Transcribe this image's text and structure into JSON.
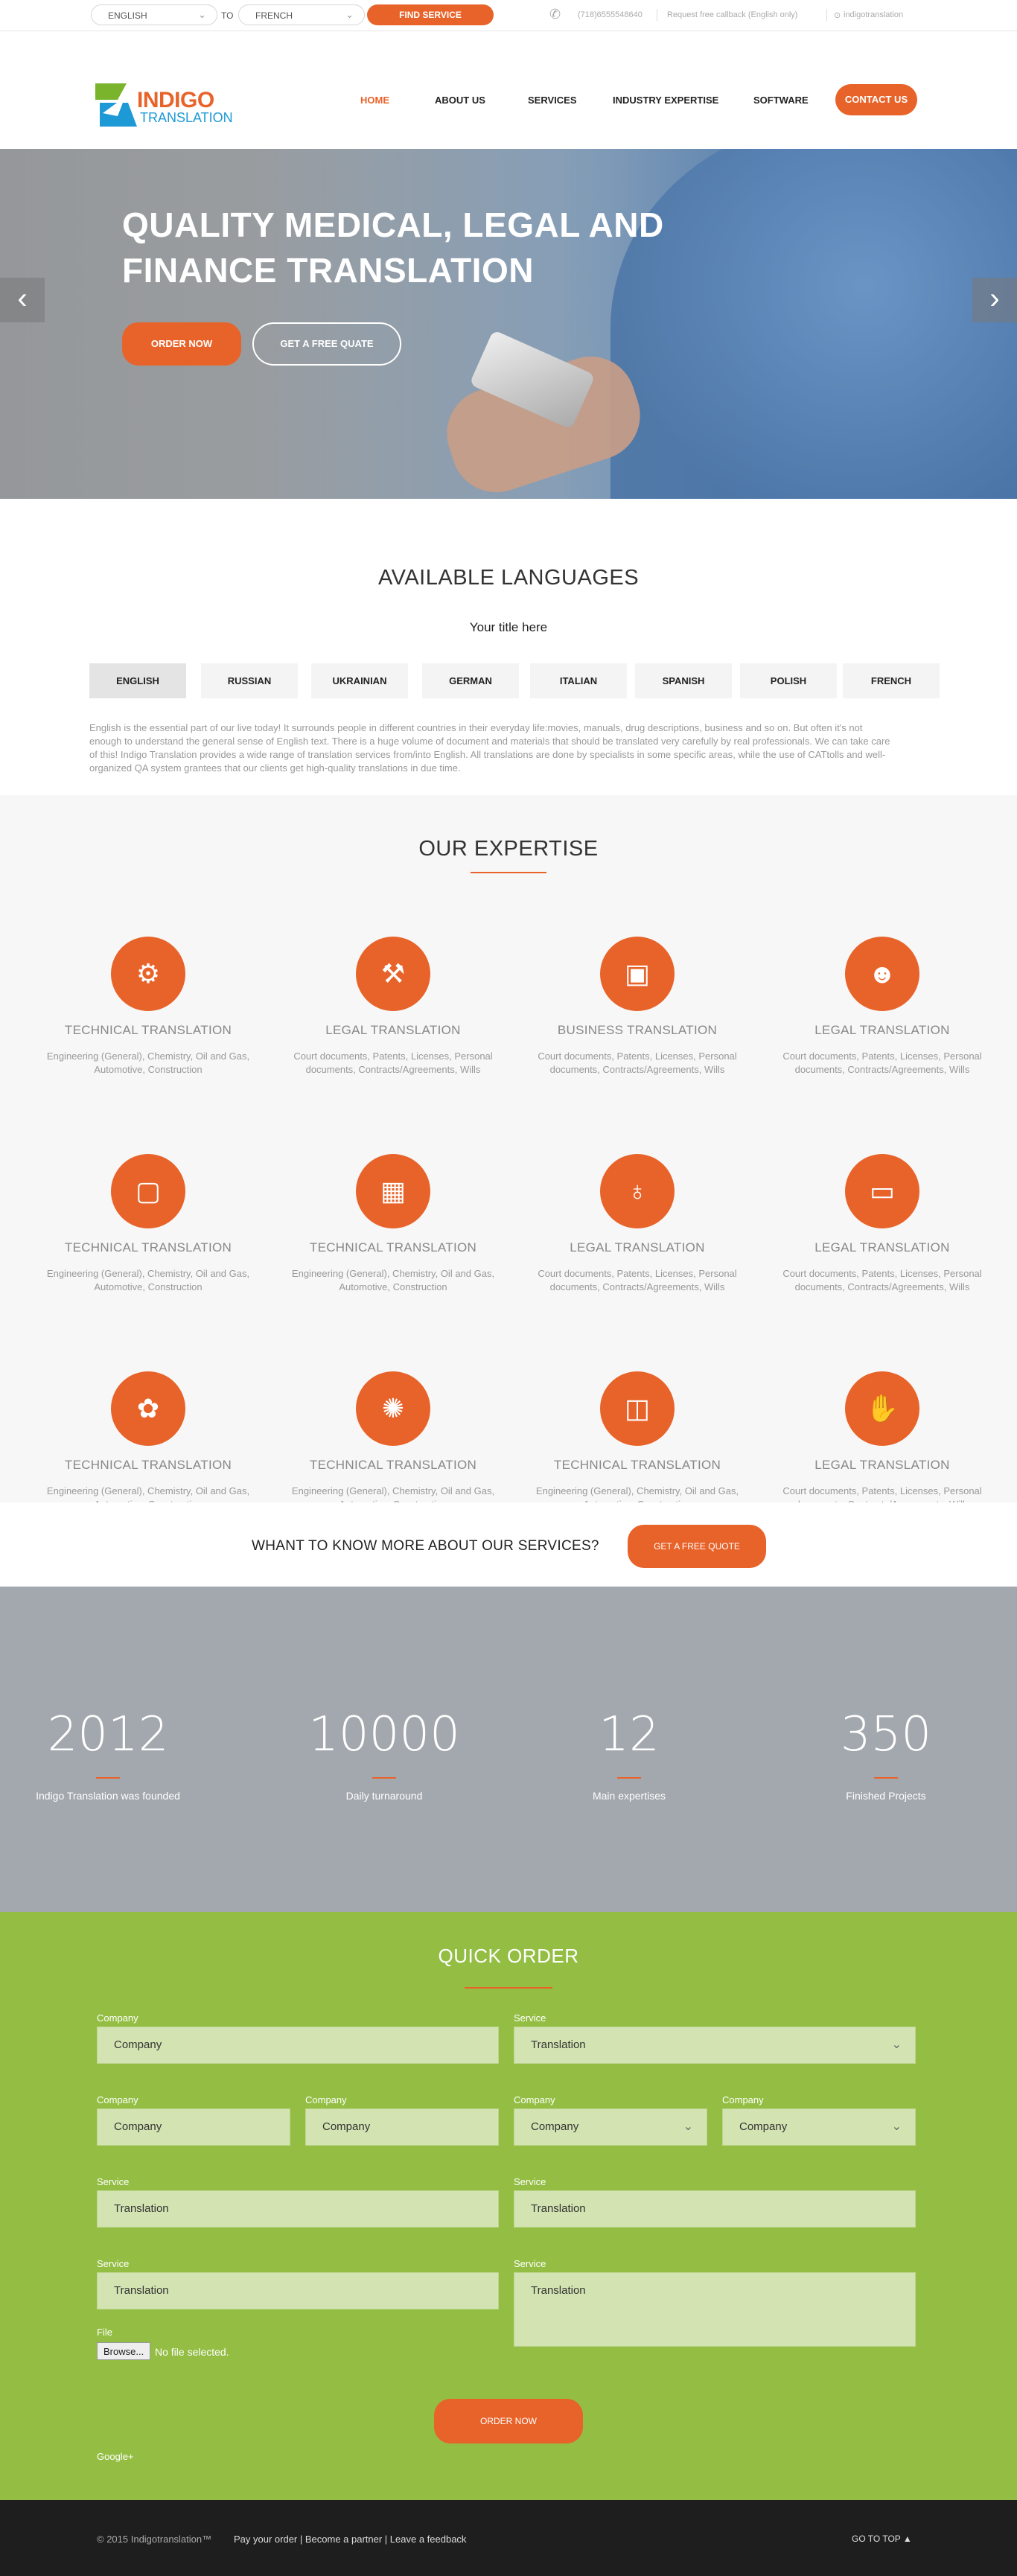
{
  "topbar": {
    "from_lang": "ENGLISH",
    "to_label": "TO",
    "to_lang": "FRENCH",
    "find_button": "FIND SERVICE",
    "phone": "(718)6555548640",
    "callback": "Request free callback (English only)",
    "skype": "indigotranslation"
  },
  "header": {
    "logo_top": "INDIGO",
    "logo_bottom": "TRANSLATION",
    "nav": [
      "HOME",
      "ABOUT US",
      "SERVICES",
      "INDUSTRY EXPERTISE",
      "SOFTWARE"
    ],
    "contact_button": "CONTACT US"
  },
  "hero": {
    "title": "QUALITY MEDICAL, LEGAL AND FINANCE TRANSLATION",
    "order_button": "ORDER NOW",
    "quote_button": "GET A FREE QUATE",
    "prev": "‹",
    "next": "›"
  },
  "languages": {
    "heading": "AVAILABLE LANGUAGES",
    "subtitle": "Your title here",
    "tabs": [
      "ENGLISH",
      "RUSSIAN",
      "UKRAINIAN",
      "GERMAN",
      "ITALIAN",
      "SPANISH",
      "POLISH",
      "FRENCH"
    ],
    "active_tab": "ENGLISH",
    "text": "English is the essential part of our live today! It surrounds people in different countries in their everyday life:movies, manuals, drug descriptions, business and so on. But often it's not enough to understand the general sense of English text. There is a huge volume of document and materials that should be translated very carefully by real professionals. We can take care of this! Indigo Translation provides a wide range of translation services from/into English. All translations are done by specialists in some specific areas, while the use of CATtolls and well-organized QA system grantees that our clients get high-quality translations in due time."
  },
  "expertise": {
    "heading": "OUR EXPERTISE",
    "items": [
      {
        "icon": "gears-icon",
        "glyph": "⚙",
        "title": "TECHNICAL TRANSLATION",
        "desc": "Engineering (General), Chemistry, Oil and Gas, Automotive, Construction"
      },
      {
        "icon": "gavel-icon",
        "glyph": "⚒",
        "title": "LEGAL TRANSLATION",
        "desc": "Court documents, Patents, Licenses, Personal documents, Contracts/Agreements, Wills"
      },
      {
        "icon": "briefcase-icon",
        "glyph": "▣",
        "title": "BUSINESS TRANSLATION",
        "desc": "Court documents, Patents, Licenses, Personal documents, Contracts/Agreements, Wills"
      },
      {
        "icon": "person-icon",
        "glyph": "☻",
        "title": "LEGAL TRANSLATION",
        "desc": "Court documents, Patents, Licenses, Personal documents, Contracts/Agreements, Wills"
      },
      {
        "icon": "book-icon",
        "glyph": "▢",
        "title": "TECHNICAL TRANSLATION",
        "desc": "Engineering (General), Chemistry, Oil and Gas, Automotive, Construction"
      },
      {
        "icon": "film-icon",
        "glyph": "▦",
        "title": "TECHNICAL TRANSLATION",
        "desc": "Engineering (General), Chemistry, Oil and Gas, Automotive, Construction"
      },
      {
        "icon": "lightbulb-icon",
        "glyph": "♁",
        "title": "LEGAL TRANSLATION",
        "desc": "Court documents, Patents, Licenses, Personal documents, Contracts/Agreements, Wills"
      },
      {
        "icon": "monitor-icon",
        "glyph": "▭",
        "title": "LEGAL TRANSLATION",
        "desc": "Court documents, Patents, Licenses, Personal documents, Contracts/Agreements, Wills"
      },
      {
        "icon": "paw-icon",
        "glyph": "✿",
        "title": "TECHNICAL TRANSLATION",
        "desc": "Engineering (General), Chemistry, Oil and Gas, Automotive, Construction"
      },
      {
        "icon": "atom-icon",
        "glyph": "✺",
        "title": "TECHNICAL TRANSLATION",
        "desc": "Engineering (General), Chemistry, Oil and Gas, Automotive, Construction"
      },
      {
        "icon": "wallet-icon",
        "glyph": "◫",
        "title": "TECHNICAL TRANSLATION",
        "desc": "Engineering (General), Chemistry, Oil and Gas, Automotive, Construction"
      },
      {
        "icon": "thumbs-up-icon",
        "glyph": "✋",
        "title": "LEGAL TRANSLATION",
        "desc": "Court documents, Patents, Licenses, Personal documents, Contracts/Agreements, Wills"
      }
    ]
  },
  "cta": {
    "text": "WHANT TO KNOW MORE ABOUT OUR SERVICES?",
    "button": "GET A FREE QUOTE"
  },
  "stats": [
    {
      "value": "2012",
      "label": "Indigo Translation was founded"
    },
    {
      "value": "10000",
      "label": "Daily turnaround"
    },
    {
      "value": "12",
      "label": "Main expertises"
    },
    {
      "value": "350",
      "label": "Finished Projects"
    }
  ],
  "order": {
    "heading": "QUICK ORDER",
    "fields": [
      {
        "label": "Company",
        "value": "Company"
      },
      {
        "label": "Service",
        "value": "Translation"
      },
      {
        "label": "Company",
        "value": "Company"
      },
      {
        "label": "Company",
        "value": "Company"
      },
      {
        "label": "Company",
        "value": "Company"
      },
      {
        "label": "Company",
        "value": "Company"
      },
      {
        "label": "Service",
        "value": "Translation"
      },
      {
        "label": "Service",
        "value": "Translation"
      },
      {
        "label": "Service",
        "value": "Translation"
      },
      {
        "label": "Service",
        "value": "Translation"
      }
    ],
    "file_label": "File",
    "browse": "Browse...",
    "no_file": "No file selected.",
    "submit": "ORDER NOW",
    "social": "Google+"
  },
  "footer": {
    "copyright": "© 2015 Indigotranslation™",
    "links": "Pay your order | Become a partner | Leave a feedback",
    "to_top": "GO TO TOP ▲"
  },
  "colors": {
    "accent": "#e8632a",
    "green": "#93be43",
    "stats_bg": "#a3a8ae",
    "footer_bg": "#1e1e1e"
  }
}
